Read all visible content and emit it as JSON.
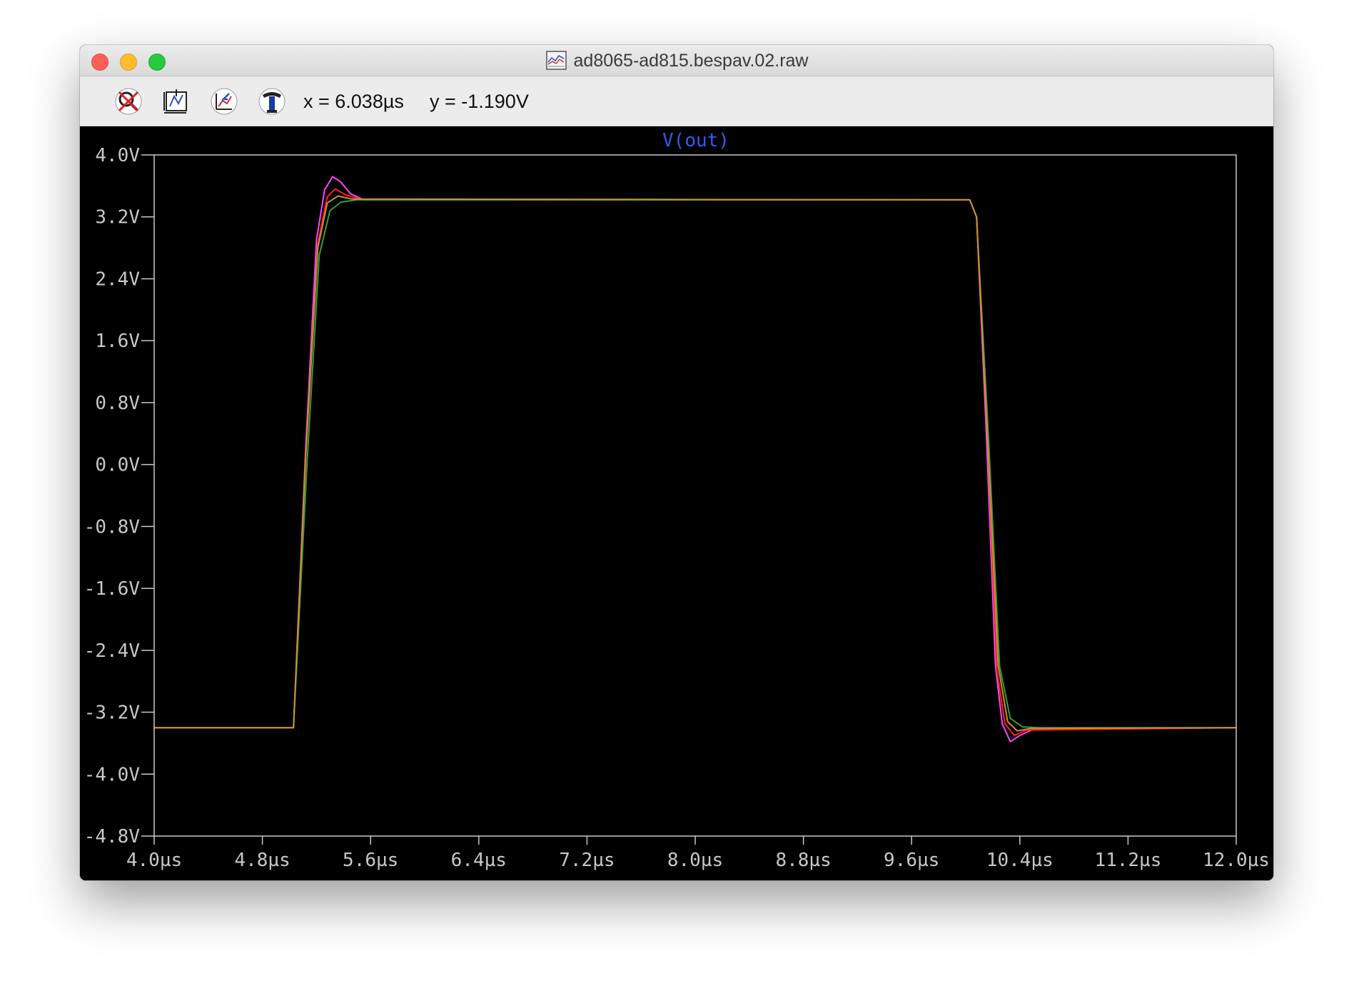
{
  "window": {
    "title": "ad8065-ad815.bespav.02.raw"
  },
  "toolbar": {
    "tools": [
      {
        "name": "zoom-cancel-icon"
      },
      {
        "name": "zoom-fit-icon"
      },
      {
        "name": "zoom-back-icon"
      },
      {
        "name": "pointer-tool-icon"
      }
    ],
    "x_readout": "x = 6.038µs",
    "y_readout": "y = -1.190V"
  },
  "colors": {
    "background": "#000000",
    "axis": "#c8c8c8",
    "title": "#2f5cf0"
  },
  "chart_data": {
    "type": "line",
    "title": "V(out)",
    "xlabel": "",
    "ylabel": "",
    "xlim": [
      4.0,
      12.0
    ],
    "ylim": [
      -4.8,
      4.0
    ],
    "x_ticks": [
      "4.0µs",
      "4.8µs",
      "5.6µs",
      "6.4µs",
      "7.2µs",
      "8.0µs",
      "8.8µs",
      "9.6µs",
      "10.4µs",
      "11.2µs",
      "12.0µs"
    ],
    "y_ticks": [
      "4.0V",
      "3.2V",
      "2.4V",
      "1.6V",
      "0.8V",
      "0.0V",
      "-0.8V",
      "-1.6V",
      "-2.4V",
      "-3.2V",
      "-4.0V",
      "-4.8V"
    ],
    "grid": false,
    "series": [
      {
        "color": "#ff44ff",
        "points": [
          [
            4.0,
            -3.4
          ],
          [
            5.03,
            -3.4
          ],
          [
            5.12,
            0.2
          ],
          [
            5.2,
            2.9
          ],
          [
            5.26,
            3.55
          ],
          [
            5.32,
            3.72
          ],
          [
            5.38,
            3.65
          ],
          [
            5.45,
            3.5
          ],
          [
            5.55,
            3.42
          ],
          [
            10.03,
            3.42
          ],
          [
            10.08,
            3.2
          ],
          [
            10.15,
            0.5
          ],
          [
            10.22,
            -2.6
          ],
          [
            10.27,
            -3.35
          ],
          [
            10.33,
            -3.58
          ],
          [
            10.4,
            -3.5
          ],
          [
            10.5,
            -3.42
          ],
          [
            12.0,
            -3.4
          ]
        ]
      },
      {
        "color": "#ff2020",
        "points": [
          [
            4.0,
            -3.4
          ],
          [
            5.03,
            -3.4
          ],
          [
            5.12,
            0.1
          ],
          [
            5.21,
            2.85
          ],
          [
            5.28,
            3.46
          ],
          [
            5.34,
            3.56
          ],
          [
            5.42,
            3.48
          ],
          [
            5.55,
            3.42
          ],
          [
            10.03,
            3.42
          ],
          [
            10.08,
            3.2
          ],
          [
            10.16,
            0.4
          ],
          [
            10.23,
            -2.65
          ],
          [
            10.29,
            -3.35
          ],
          [
            10.36,
            -3.5
          ],
          [
            10.45,
            -3.43
          ],
          [
            12.0,
            -3.4
          ]
        ]
      },
      {
        "color": "#3a9a3a",
        "points": [
          [
            4.0,
            -3.4
          ],
          [
            5.03,
            -3.4
          ],
          [
            5.13,
            0.0
          ],
          [
            5.22,
            2.7
          ],
          [
            5.3,
            3.28
          ],
          [
            5.38,
            3.39
          ],
          [
            5.5,
            3.42
          ],
          [
            10.03,
            3.42
          ],
          [
            10.08,
            3.2
          ],
          [
            10.17,
            0.3
          ],
          [
            10.25,
            -2.6
          ],
          [
            10.33,
            -3.28
          ],
          [
            10.42,
            -3.39
          ],
          [
            10.55,
            -3.4
          ],
          [
            12.0,
            -3.4
          ]
        ]
      },
      {
        "color": "#c89030",
        "points": [
          [
            4.0,
            -3.4
          ],
          [
            5.03,
            -3.4
          ],
          [
            5.12,
            0.1
          ],
          [
            5.21,
            2.8
          ],
          [
            5.28,
            3.38
          ],
          [
            5.36,
            3.47
          ],
          [
            5.46,
            3.43
          ],
          [
            10.03,
            3.42
          ],
          [
            10.08,
            3.2
          ],
          [
            10.16,
            0.4
          ],
          [
            10.24,
            -2.6
          ],
          [
            10.31,
            -3.32
          ],
          [
            10.38,
            -3.44
          ],
          [
            10.48,
            -3.41
          ],
          [
            12.0,
            -3.4
          ]
        ]
      }
    ]
  }
}
